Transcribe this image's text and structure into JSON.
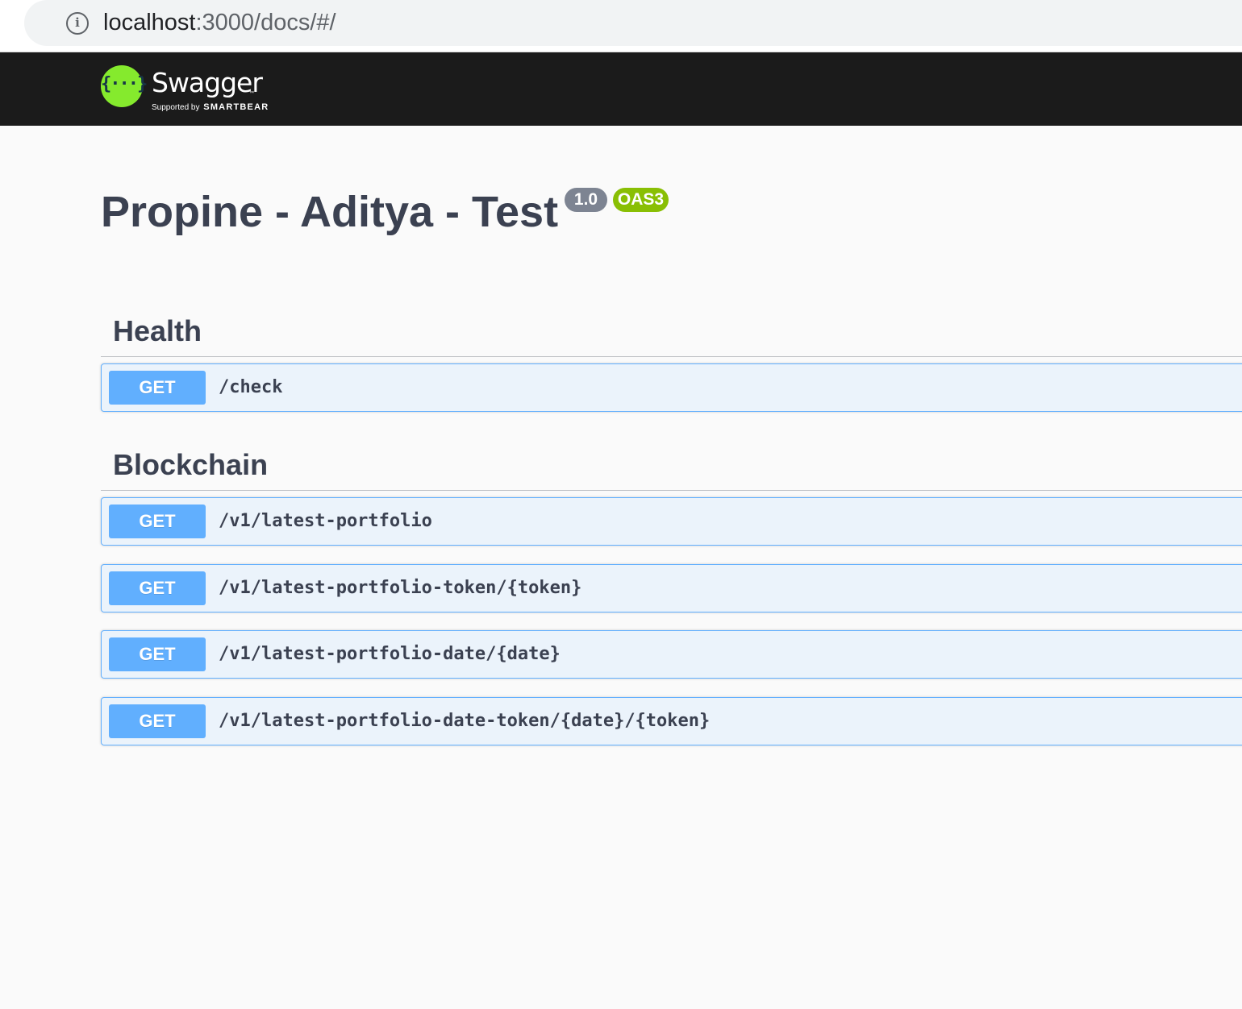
{
  "browser": {
    "url_host": "localhost",
    "url_path": ":3000/docs/#/",
    "info_icon": "info-icon"
  },
  "topbar": {
    "logo_symbol": "{···}",
    "logo_name": "Swagger",
    "logo_tm": "™",
    "supported_by": "Supported by",
    "company": "SMARTBEAR"
  },
  "info": {
    "title": "Propine - Aditya - Test",
    "version": "1.0",
    "oas_badge": "OAS3"
  },
  "colors": {
    "get_method": "#61affe",
    "oas_badge": "#89bf04",
    "version_badge": "#7d8492",
    "swagger_green": "#85ea2d"
  },
  "tags": [
    {
      "name": "Health",
      "operations": [
        {
          "method": "GET",
          "path": "/check"
        }
      ]
    },
    {
      "name": "Blockchain",
      "operations": [
        {
          "method": "GET",
          "path": "/v1/latest-portfolio"
        },
        {
          "method": "GET",
          "path": "/v1/latest-portfolio-token/{token}"
        },
        {
          "method": "GET",
          "path": "/v1/latest-portfolio-date/{date}"
        },
        {
          "method": "GET",
          "path": "/v1/latest-portfolio-date-token/{date}/{token}"
        }
      ]
    }
  ]
}
